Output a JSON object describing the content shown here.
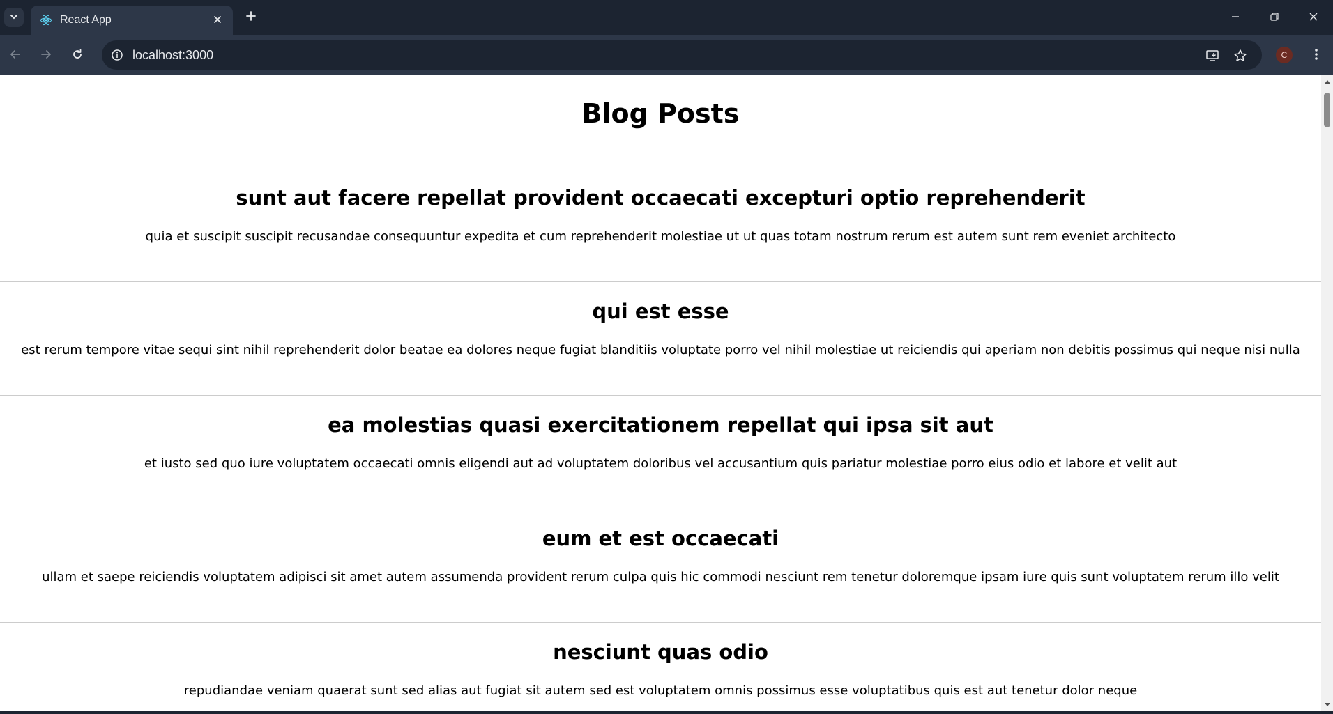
{
  "browser": {
    "tab": {
      "title": "React App",
      "favicon": "react-logo-icon"
    },
    "address_bar": {
      "url": "localhost:3000"
    },
    "profile": {
      "initial": "C",
      "color": "#6b2b22"
    },
    "icons": {
      "tab_search": "chevron-down-icon",
      "close_tab": "close-icon",
      "new_tab": "plus-icon",
      "minimize": "minimize-icon",
      "restore": "restore-icon",
      "close_window": "close-icon",
      "back": "arrow-left-icon",
      "forward": "arrow-right-icon",
      "reload": "reload-icon",
      "site_info": "info-icon",
      "install_app": "install-icon",
      "bookmark": "star-icon",
      "menu": "kebab-menu-icon"
    }
  },
  "page": {
    "heading": "Blog Posts",
    "posts": [
      {
        "title": "sunt aut facere repellat provident occaecati excepturi optio reprehenderit",
        "body": "quia et suscipit suscipit recusandae consequuntur expedita et cum reprehenderit molestiae ut ut quas totam nostrum rerum est autem sunt rem eveniet architecto"
      },
      {
        "title": "qui est esse",
        "body": "est rerum tempore vitae sequi sint nihil reprehenderit dolor beatae ea dolores neque fugiat blanditiis voluptate porro vel nihil molestiae ut reiciendis qui aperiam non debitis possimus qui neque nisi nulla"
      },
      {
        "title": "ea molestias quasi exercitationem repellat qui ipsa sit aut",
        "body": "et iusto sed quo iure voluptatem occaecati omnis eligendi aut ad voluptatem doloribus vel accusantium quis pariatur molestiae porro eius odio et labore et velit aut"
      },
      {
        "title": "eum et est occaecati",
        "body": "ullam et saepe reiciendis voluptatem adipisci sit amet autem assumenda provident rerum culpa quis hic commodi nesciunt rem tenetur doloremque ipsam iure quis sunt voluptatem rerum illo velit"
      },
      {
        "title": "nesciunt quas odio",
        "body": "repudiandae veniam quaerat sunt sed alias aut fugiat sit autem sed est voluptatem omnis possimus esse voluptatibus quis est aut tenetur dolor neque"
      }
    ]
  }
}
